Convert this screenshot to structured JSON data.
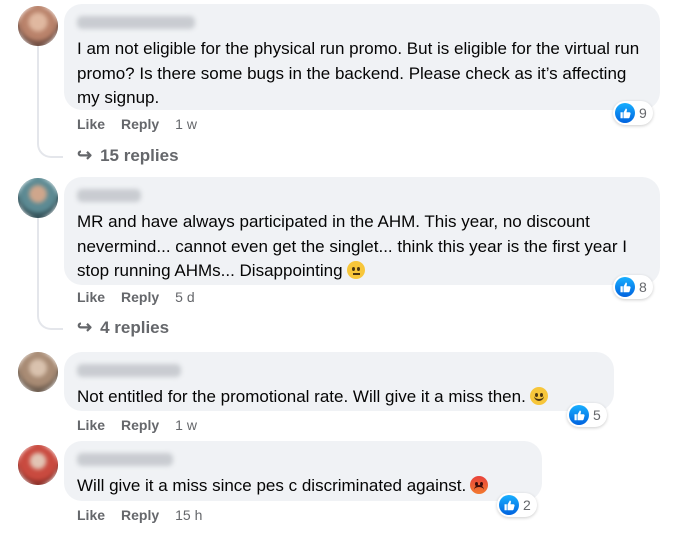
{
  "comments": [
    {
      "author": "Hsu Huimei Lin",
      "text": "I am not eligible for the physical run promo. But is eligible for the virtual run promo? Is there some bugs in the backend. Please check as it’s affecting my signup.",
      "reaction_count": "9",
      "like": "Like",
      "reply": "Reply",
      "time": "1 w",
      "replies": "15 replies",
      "avatar_color": "#b9826a"
    },
    {
      "author": "Henry Yi",
      "text": "MR and have always participated in the AHM. This year, no discount nevermind... cannot even get the singlet... think this year is the first year I stop running AHMs... Disappointing",
      "emoji": "thinking-face",
      "reaction_count": "8",
      "like": "Like",
      "reply": "Reply",
      "time": "5 d",
      "replies": "4 replies",
      "avatar_color": "#5c8a93"
    },
    {
      "author": "Narkos Phone",
      "text": "Not entitled for the promotional rate. Will give it a miss then.",
      "emoji": "smiling-face",
      "reaction_count": "5",
      "like": "Like",
      "reply": "Reply",
      "time": "1 w",
      "avatar_color": "#a88b74"
    },
    {
      "author": "Michael Koh",
      "text": "Will give it a miss since pes c discriminated against.",
      "emoji": "angry-face",
      "reaction_count": "2",
      "like": "Like",
      "reply": "Reply",
      "time": "15 h",
      "avatar_color": "#c94a3f"
    }
  ],
  "colors": {
    "bubble": "#f0f2f5",
    "secondary_text": "#65676b",
    "like_blue": "#0866ff"
  }
}
